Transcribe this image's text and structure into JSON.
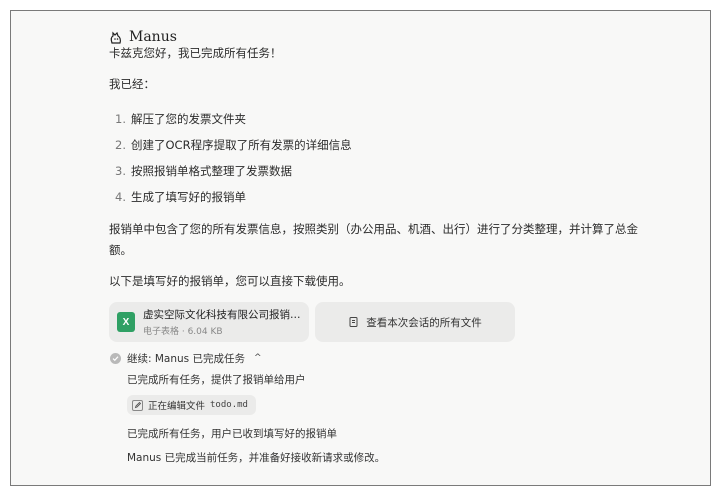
{
  "header": {
    "brand": "Manus"
  },
  "message": {
    "greeting": "卡兹克您好，我已完成所有任务！",
    "intro": "我已经：",
    "steps": [
      {
        "num": "1.",
        "text": "解压了您的发票文件夹"
      },
      {
        "num": "2.",
        "text": "创建了OCR程序提取了所有发票的详细信息"
      },
      {
        "num": "3.",
        "text": "按照报销单格式整理了发票数据"
      },
      {
        "num": "4.",
        "text": "生成了填写好的报销单"
      }
    ],
    "summary": "报销单中包含了您的所有发票信息，按照类别（办公用品、机酒、出行）进行了分类整理，并计算了总金额。",
    "download_note": "以下是填写好的报销单，您可以直接下载使用。"
  },
  "attachment": {
    "name": "虚实空际文化科技有限公司报销单...",
    "meta": "电子表格 · 6.04 KB",
    "icon_letter": "X",
    "icon_color": "#2fa064"
  },
  "all_files_button": {
    "label": "查看本次会话的所有文件"
  },
  "task_status": {
    "label": "继续:   Manus 已完成任务",
    "chevron": "^",
    "update1": "已完成所有任务，提供了报销单给用户",
    "editing_label": "正在编辑文件",
    "editing_file": "todo.md",
    "update2": "已完成所有任务，用户已收到填写好的报销单",
    "update3": "Manus 已完成当前任务，并准备好接收新请求或修改。"
  }
}
